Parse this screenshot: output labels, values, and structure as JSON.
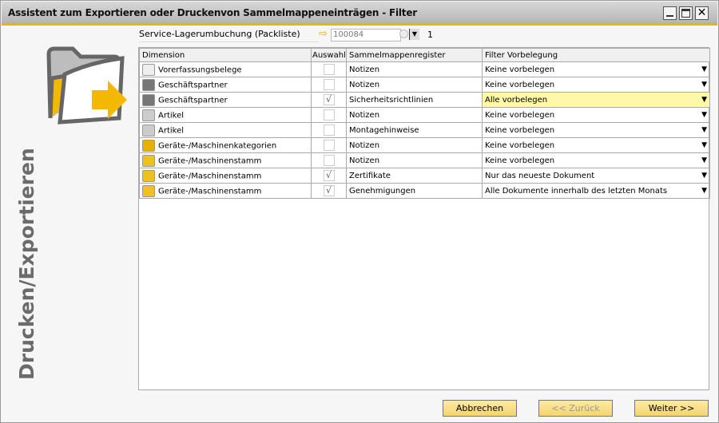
{
  "window": {
    "title": "Assistent zum Exportieren oder Druckenvon Sammelmappeneinträgen - Filter"
  },
  "service": {
    "label": "Service-Lagerumbuchung (Packliste)",
    "value": "100084",
    "count": "1"
  },
  "side_label": "Drucken/Exportieren",
  "table": {
    "headers": [
      "Dimension",
      "Auswahl",
      "Sammelmappenregister",
      "Filter Vorbelegung"
    ],
    "rows": [
      {
        "icon": "document-check-icon",
        "dimension": "Vorerfassungsbelege",
        "checked": false,
        "register": "Notizen",
        "filter": "Keine vorbelegen"
      },
      {
        "icon": "business-partner-icon",
        "dimension": "Geschäftspartner",
        "checked": false,
        "register": "Notizen",
        "filter": "Keine vorbelegen"
      },
      {
        "icon": "business-partner-icon",
        "dimension": "Geschäftspartner",
        "checked": true,
        "register": "Sicherheitsrichtlinien",
        "filter": "Alle vorbelegen"
      },
      {
        "icon": "item-gear-icon",
        "dimension": "Artikel",
        "checked": false,
        "register": "Notizen",
        "filter": "Keine vorbelegen"
      },
      {
        "icon": "item-gear-icon",
        "dimension": "Artikel",
        "checked": false,
        "register": "Montagehinweise",
        "filter": "Keine vorbelegen"
      },
      {
        "icon": "equipment-category-icon",
        "dimension": "Geräte-/Maschinenkategorien",
        "checked": false,
        "register": "Notizen",
        "filter": "Keine vorbelegen"
      },
      {
        "icon": "equipment-icon",
        "dimension": "Geräte-/Maschinenstamm",
        "checked": false,
        "register": "Notizen",
        "filter": "Keine vorbelegen"
      },
      {
        "icon": "equipment-icon",
        "dimension": "Geräte-/Maschinenstamm",
        "checked": true,
        "register": "Zertifikate",
        "filter": "Nur das neueste Dokument"
      },
      {
        "icon": "equipment-icon",
        "dimension": "Geräte-/Maschinenstamm",
        "checked": true,
        "register": "Genehmigungen",
        "filter": "Alle Dokumente innerhalb des letzten Monats"
      }
    ]
  },
  "buttons": {
    "cancel": "Abbrechen",
    "back": "<< Zurück",
    "next": "Weiter >>"
  }
}
